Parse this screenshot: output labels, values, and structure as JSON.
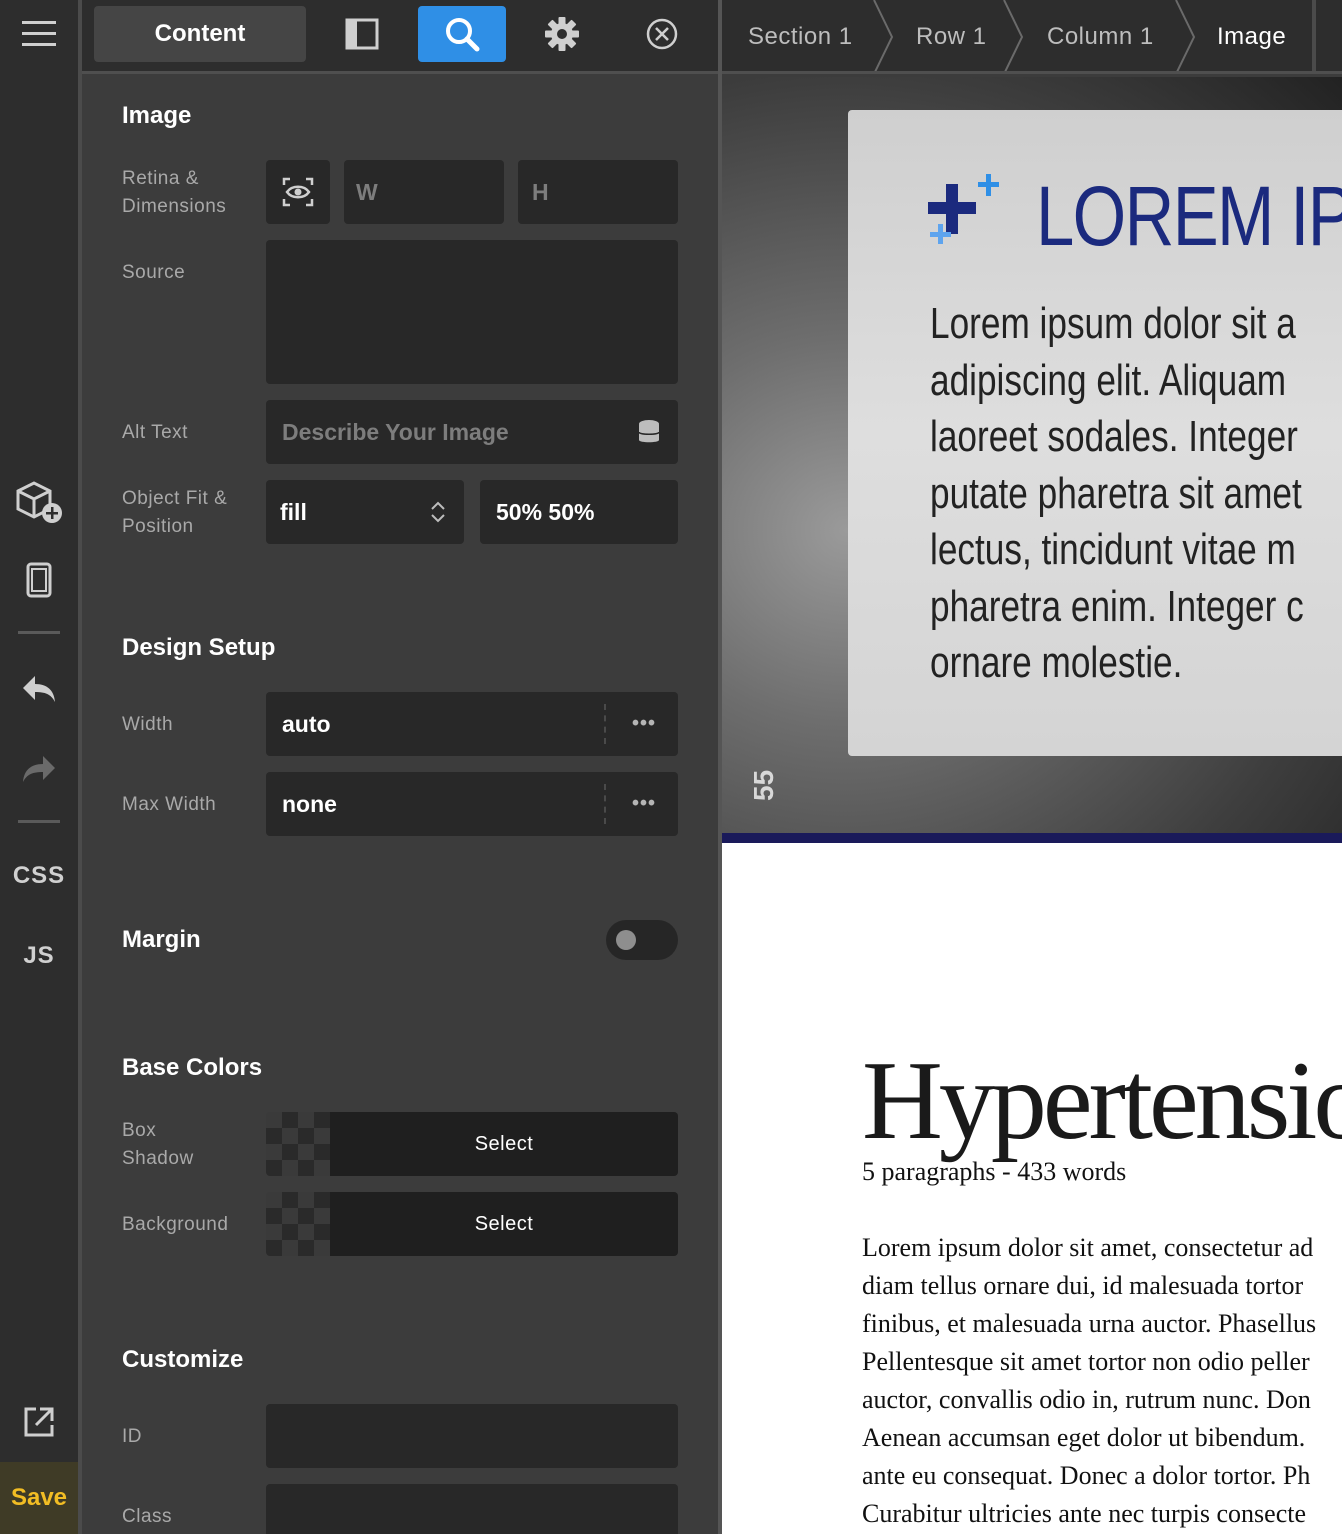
{
  "rail": {
    "css_label": "CSS",
    "js_label": "JS",
    "save_label": "Save"
  },
  "tabs": {
    "content_label": "Content"
  },
  "breadcrumb": [
    "Section 1",
    "Row 1",
    "Column 1",
    "Image"
  ],
  "panel": {
    "image": {
      "title": "Image",
      "retina_label_1": "Retina &",
      "retina_label_2": "Dimensions",
      "width_placeholder": "W",
      "height_placeholder": "H",
      "source_label": "Source",
      "alt_label": "Alt Text",
      "alt_placeholder": "Describe Your Image",
      "objfit_label_1": "Object Fit &",
      "objfit_label_2": "Position",
      "object_fit_value": "fill",
      "object_position_value": "50% 50%"
    },
    "design": {
      "title": "Design Setup",
      "width_label": "Width",
      "width_value": "auto",
      "max_width_label": "Max Width",
      "max_width_value": "none"
    },
    "margin": {
      "title": "Margin"
    },
    "colors": {
      "title": "Base Colors",
      "box_shadow_label_1": "Box",
      "box_shadow_label_2": "Shadow",
      "box_shadow_button": "Select",
      "background_label": "Background",
      "background_button": "Select"
    },
    "customize": {
      "title": "Customize",
      "id_label": "ID",
      "class_label": "Class"
    }
  },
  "preview": {
    "hero_heading": "LOREM IP",
    "hero_body": "Lorem ipsum dolor sit a\nadipiscing elit. Aliquam\nlaoreet sodales. Integer\nputate pharetra sit amet\nlectus, tincidunt vitae m\npharetra enim. Integer c\nornare molestie.",
    "hero_tag": "55",
    "doc_title": "Hypertensio",
    "doc_meta": "5 paragraphs - 433 words",
    "doc_lines": [
      "Lorem ipsum dolor sit amet, consectetur ad",
      "diam tellus ornare dui, id malesuada tortor",
      "finibus, et malesuada urna auctor. Phasellus",
      "Pellentesque sit amet tortor non odio peller",
      "auctor, convallis odio in, rutrum nunc. Don",
      "Aenean accumsan eget dolor ut bibendum.",
      "ante eu consequat. Donec a dolor tortor. Ph",
      "Curabitur ultricies ante nec turpis consecte"
    ]
  },
  "colors": {
    "accent": "#2f8fe6",
    "save": "#f2bd24",
    "hero_heading": "#1b2a7e"
  }
}
